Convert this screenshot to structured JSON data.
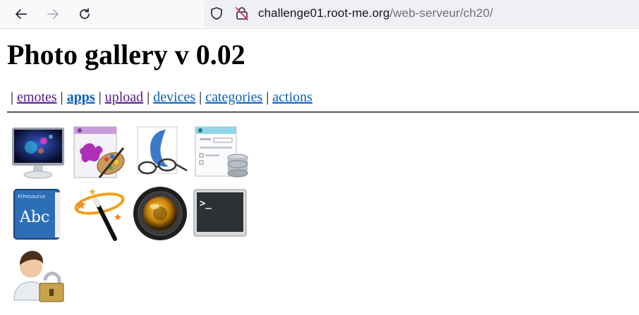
{
  "browser": {
    "url_host": "challenge01.root-me.org",
    "url_path": "/web-serveur/ch20/",
    "icons": [
      "back-arrow-icon",
      "forward-arrow-icon",
      "reload-icon",
      "shield-icon",
      "insecure-lock-icon"
    ]
  },
  "page": {
    "title": "Photo gallery v 0.02",
    "menu": [
      {
        "label": "emotes",
        "state": "visited"
      },
      {
        "label": "apps",
        "state": "active"
      },
      {
        "label": "upload",
        "state": "visited"
      },
      {
        "label": "devices",
        "state": "link"
      },
      {
        "label": "categories",
        "state": "link"
      },
      {
        "label": "actions",
        "state": "link"
      }
    ],
    "separator": "|"
  },
  "gallery": {
    "images": [
      {
        "icon": "monitor-icon"
      },
      {
        "icon": "paint-palette-icon"
      },
      {
        "icon": "glasses-editor-icon"
      },
      {
        "icon": "database-form-icon"
      },
      {
        "icon": "thesaurus-book-icon"
      },
      {
        "icon": "magic-wand-icon"
      },
      {
        "icon": "camera-lens-icon"
      },
      {
        "icon": "terminal-icon"
      },
      {
        "icon": "user-lock-icon"
      }
    ],
    "book_cover_text": "Abc",
    "book_top_text": "Kthesaurus",
    "terminal_prompt": ">_"
  },
  "colors": {
    "visited_link": "#551a8b",
    "link": "#0b5fbf",
    "toolbar_bg": "#f9f9fb",
    "urlbar_bg": "#f0f0f4"
  }
}
